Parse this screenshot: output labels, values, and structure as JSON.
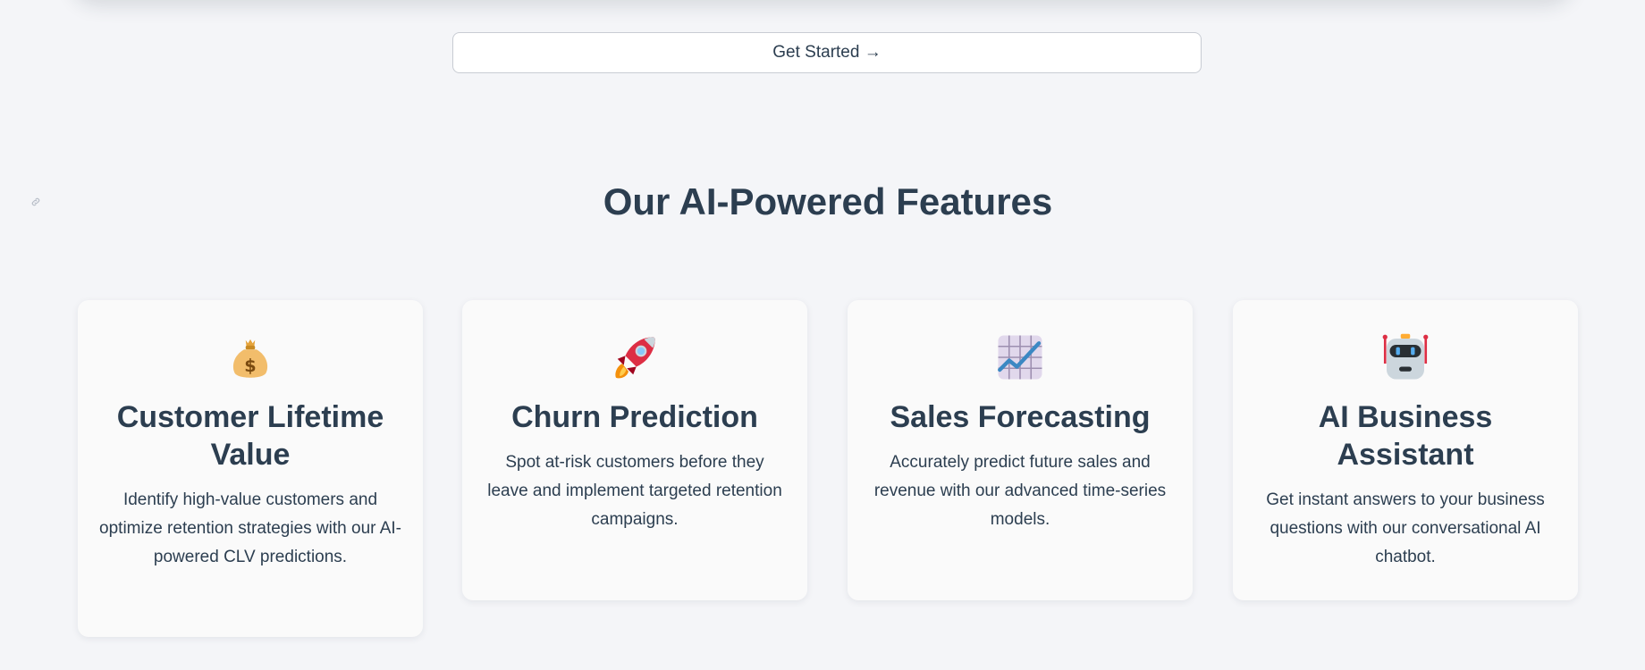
{
  "cta": {
    "label": "Get Started →"
  },
  "features": {
    "title": "Our AI-Powered Features",
    "cards": [
      {
        "icon": "money-bag-icon",
        "title": "Customer Lifetime Value",
        "description": "Identify high-value customers and optimize retention strategies with our AI-powered CLV predictions."
      },
      {
        "icon": "rocket-icon",
        "title": "Churn Prediction",
        "description": "Spot at-risk customers before they leave and implement targeted retention campaigns."
      },
      {
        "icon": "chart-increasing-icon",
        "title": "Sales Forecasting",
        "description": "Accurately predict future sales and revenue with our advanced time-series models."
      },
      {
        "icon": "robot-icon",
        "title": "AI Business Assistant",
        "description": "Get instant answers to your business questions with our conversational AI chatbot."
      }
    ]
  },
  "colors": {
    "background": "#f4f5f8",
    "text": "#2c3e50",
    "card": "#fafafa"
  }
}
